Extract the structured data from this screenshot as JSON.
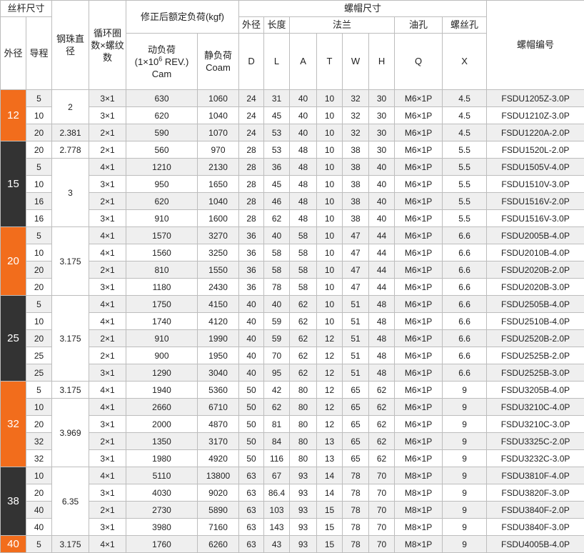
{
  "header": {
    "screw_size": "丝杆尺寸",
    "ball_dia": "钢珠直径",
    "circuits": "循环圈数×螺纹数",
    "load_rating": "修正后额定负荷(kgf)",
    "nut_size": "螺帽尺寸",
    "nut_code": "螺帽编号",
    "outer_dia": "外径",
    "lead": "导程",
    "nut_outer": "外径",
    "length": "长度",
    "flange": "法兰",
    "oil_hole": "油孔",
    "screw_hole": "螺丝孔",
    "dynamic_line1": "动负荷",
    "dynamic_base": "(1×10",
    "dynamic_exp": "6",
    "dynamic_tail": " REV.)",
    "dynamic_cam": "Cam",
    "static_line1": "静负荷",
    "static_coam": "Coam",
    "col_D": "D",
    "col_L": "L",
    "col_A": "A",
    "col_T": "T",
    "col_W": "W",
    "col_H": "H",
    "col_Q": "Q",
    "col_X": "X"
  },
  "groups": [
    {
      "dia": "12",
      "color": "orange",
      "rows": [
        {
          "lead": "5",
          "circ": "3×1",
          "cam": "630",
          "coam": "1060",
          "D": "24",
          "L": "31",
          "A": "40",
          "T": "10",
          "W": "32",
          "H": "30",
          "Q": "M6×1P",
          "X": "4.5",
          "code": "FSDU1205Z-3.0P"
        },
        {
          "lead": "10",
          "circ": "3×1",
          "cam": "620",
          "coam": "1040",
          "D": "24",
          "L": "45",
          "A": "40",
          "T": "10",
          "W": "32",
          "H": "30",
          "Q": "M6×1P",
          "X": "4.5",
          "code": "FSDU1210Z-3.0P"
        },
        {
          "lead": "20",
          "circ": "2×1",
          "cam": "590",
          "coam": "1070",
          "D": "24",
          "L": "53",
          "A": "40",
          "T": "10",
          "W": "32",
          "H": "30",
          "Q": "M6×1P",
          "X": "4.5",
          "code": "FSDU1220A-2.0P"
        }
      ],
      "balls": [
        {
          "value": "2",
          "span": 2
        },
        {
          "value": "2.381",
          "span": 1
        }
      ]
    },
    {
      "dia": "15",
      "color": "dark",
      "rows": [
        {
          "lead": "20",
          "circ": "2×1",
          "cam": "560",
          "coam": "970",
          "D": "28",
          "L": "53",
          "A": "48",
          "T": "10",
          "W": "38",
          "H": "30",
          "Q": "M6×1P",
          "X": "5.5",
          "code": "FSDU1520L-2.0P"
        },
        {
          "lead": "5",
          "circ": "4×1",
          "cam": "1210",
          "coam": "2130",
          "D": "28",
          "L": "36",
          "A": "48",
          "T": "10",
          "W": "38",
          "H": "40",
          "Q": "M6×1P",
          "X": "5.5",
          "code": "FSDU1505V-4.0P"
        },
        {
          "lead": "10",
          "circ": "3×1",
          "cam": "950",
          "coam": "1650",
          "D": "28",
          "L": "45",
          "A": "48",
          "T": "10",
          "W": "38",
          "H": "40",
          "Q": "M6×1P",
          "X": "5.5",
          "code": "FSDU1510V-3.0P"
        },
        {
          "lead": "16",
          "circ": "2×1",
          "cam": "620",
          "coam": "1040",
          "D": "28",
          "L": "46",
          "A": "48",
          "T": "10",
          "W": "38",
          "H": "40",
          "Q": "M6×1P",
          "X": "5.5",
          "code": "FSDU1516V-2.0P"
        },
        {
          "lead": "16",
          "circ": "3×1",
          "cam": "910",
          "coam": "1600",
          "D": "28",
          "L": "62",
          "A": "48",
          "T": "10",
          "W": "38",
          "H": "40",
          "Q": "M6×1P",
          "X": "5.5",
          "code": "FSDU1516V-3.0P"
        }
      ],
      "balls": [
        {
          "value": "2.778",
          "span": 1
        },
        {
          "value": "3",
          "span": 4
        }
      ]
    },
    {
      "dia": "20",
      "color": "orange",
      "rows": [
        {
          "lead": "5",
          "circ": "4×1",
          "cam": "1570",
          "coam": "3270",
          "D": "36",
          "L": "40",
          "A": "58",
          "T": "10",
          "W": "47",
          "H": "44",
          "Q": "M6×1P",
          "X": "6.6",
          "code": "FSDU2005B-4.0P"
        },
        {
          "lead": "10",
          "circ": "4×1",
          "cam": "1560",
          "coam": "3250",
          "D": "36",
          "L": "58",
          "A": "58",
          "T": "10",
          "W": "47",
          "H": "44",
          "Q": "M6×1P",
          "X": "6.6",
          "code": "FSDU2010B-4.0P"
        },
        {
          "lead": "20",
          "circ": "2×1",
          "cam": "810",
          "coam": "1550",
          "D": "36",
          "L": "58",
          "A": "58",
          "T": "10",
          "W": "47",
          "H": "44",
          "Q": "M6×1P",
          "X": "6.6",
          "code": "FSDU2020B-2.0P"
        },
        {
          "lead": "20",
          "circ": "3×1",
          "cam": "1180",
          "coam": "2430",
          "D": "36",
          "L": "78",
          "A": "58",
          "T": "10",
          "W": "47",
          "H": "44",
          "Q": "M6×1P",
          "X": "6.6",
          "code": "FSDU2020B-3.0P"
        }
      ],
      "balls": [
        {
          "value": "3.175",
          "span": 4
        }
      ]
    },
    {
      "dia": "25",
      "color": "dark",
      "rows": [
        {
          "lead": "5",
          "circ": "4×1",
          "cam": "1750",
          "coam": "4150",
          "D": "40",
          "L": "40",
          "A": "62",
          "T": "10",
          "W": "51",
          "H": "48",
          "Q": "M6×1P",
          "X": "6.6",
          "code": "FSDU2505B-4.0P"
        },
        {
          "lead": "10",
          "circ": "4×1",
          "cam": "1740",
          "coam": "4120",
          "D": "40",
          "L": "59",
          "A": "62",
          "T": "10",
          "W": "51",
          "H": "48",
          "Q": "M6×1P",
          "X": "6.6",
          "code": "FSDU2510B-4.0P"
        },
        {
          "lead": "20",
          "circ": "2×1",
          "cam": "910",
          "coam": "1990",
          "D": "40",
          "L": "59",
          "A": "62",
          "T": "12",
          "W": "51",
          "H": "48",
          "Q": "M6×1P",
          "X": "6.6",
          "code": "FSDU2520B-2.0P"
        },
        {
          "lead": "25",
          "circ": "2×1",
          "cam": "900",
          "coam": "1950",
          "D": "40",
          "L": "70",
          "A": "62",
          "T": "12",
          "W": "51",
          "H": "48",
          "Q": "M6×1P",
          "X": "6.6",
          "code": "FSDU2525B-2.0P"
        },
        {
          "lead": "25",
          "circ": "3×1",
          "cam": "1290",
          "coam": "3040",
          "D": "40",
          "L": "95",
          "A": "62",
          "T": "12",
          "W": "51",
          "H": "48",
          "Q": "M6×1P",
          "X": "6.6",
          "code": "FSDU2525B-3.0P"
        }
      ],
      "balls": [
        {
          "value": "3.175",
          "span": 5
        }
      ]
    },
    {
      "dia": "32",
      "color": "orange",
      "rows": [
        {
          "lead": "5",
          "circ": "4×1",
          "cam": "1940",
          "coam": "5360",
          "D": "50",
          "L": "42",
          "A": "80",
          "T": "12",
          "W": "65",
          "H": "62",
          "Q": "M6×1P",
          "X": "9",
          "code": "FSDU3205B-4.0P"
        },
        {
          "lead": "10",
          "circ": "4×1",
          "cam": "2660",
          "coam": "6710",
          "D": "50",
          "L": "62",
          "A": "80",
          "T": "12",
          "W": "65",
          "H": "62",
          "Q": "M6×1P",
          "X": "9",
          "code": "FSDU3210C-4.0P"
        },
        {
          "lead": "20",
          "circ": "3×1",
          "cam": "2000",
          "coam": "4870",
          "D": "50",
          "L": "81",
          "A": "80",
          "T": "12",
          "W": "65",
          "H": "62",
          "Q": "M6×1P",
          "X": "9",
          "code": "FSDU3210C-3.0P"
        },
        {
          "lead": "32",
          "circ": "2×1",
          "cam": "1350",
          "coam": "3170",
          "D": "50",
          "L": "84",
          "A": "80",
          "T": "13",
          "W": "65",
          "H": "62",
          "Q": "M6×1P",
          "X": "9",
          "code": "FSDU3325C-2.0P"
        },
        {
          "lead": "32",
          "circ": "3×1",
          "cam": "1980",
          "coam": "4920",
          "D": "50",
          "L": "116",
          "A": "80",
          "T": "13",
          "W": "65",
          "H": "62",
          "Q": "M6×1P",
          "X": "9",
          "code": "FSDU3232C-3.0P"
        }
      ],
      "balls": [
        {
          "value": "3.175",
          "span": 1
        },
        {
          "value": "3.969",
          "span": 4
        }
      ]
    },
    {
      "dia": "38",
      "color": "dark",
      "rows": [
        {
          "lead": "10",
          "circ": "4×1",
          "cam": "5110",
          "coam": "13800",
          "D": "63",
          "L": "67",
          "A": "93",
          "T": "14",
          "W": "78",
          "H": "70",
          "Q": "M8×1P",
          "X": "9",
          "code": "FSDU3810F-4.0P"
        },
        {
          "lead": "20",
          "circ": "3×1",
          "cam": "4030",
          "coam": "9020",
          "D": "63",
          "L": "86.4",
          "A": "93",
          "T": "14",
          "W": "78",
          "H": "70",
          "Q": "M8×1P",
          "X": "9",
          "code": "FSDU3820F-3.0P"
        },
        {
          "lead": "40",
          "circ": "2×1",
          "cam": "2730",
          "coam": "5890",
          "D": "63",
          "L": "103",
          "A": "93",
          "T": "15",
          "W": "78",
          "H": "70",
          "Q": "M8×1P",
          "X": "9",
          "code": "FSDU3840F-2.0P"
        },
        {
          "lead": "40",
          "circ": "3×1",
          "cam": "3980",
          "coam": "7160",
          "D": "63",
          "L": "143",
          "A": "93",
          "T": "15",
          "W": "78",
          "H": "70",
          "Q": "M8×1P",
          "X": "9",
          "code": "FSDU3840F-3.0P"
        }
      ],
      "balls": [
        {
          "value": "6.35",
          "span": 4
        }
      ]
    },
    {
      "dia": "40",
      "color": "orange",
      "rows": [
        {
          "lead": "5",
          "circ": "4×1",
          "cam": "1760",
          "coam": "6260",
          "D": "63",
          "L": "43",
          "A": "93",
          "T": "15",
          "W": "78",
          "H": "70",
          "Q": "M8×1P",
          "X": "9",
          "code": "FSDU4005B-4.0P"
        }
      ],
      "balls": [
        {
          "value": "3.175",
          "span": 1
        }
      ]
    }
  ]
}
